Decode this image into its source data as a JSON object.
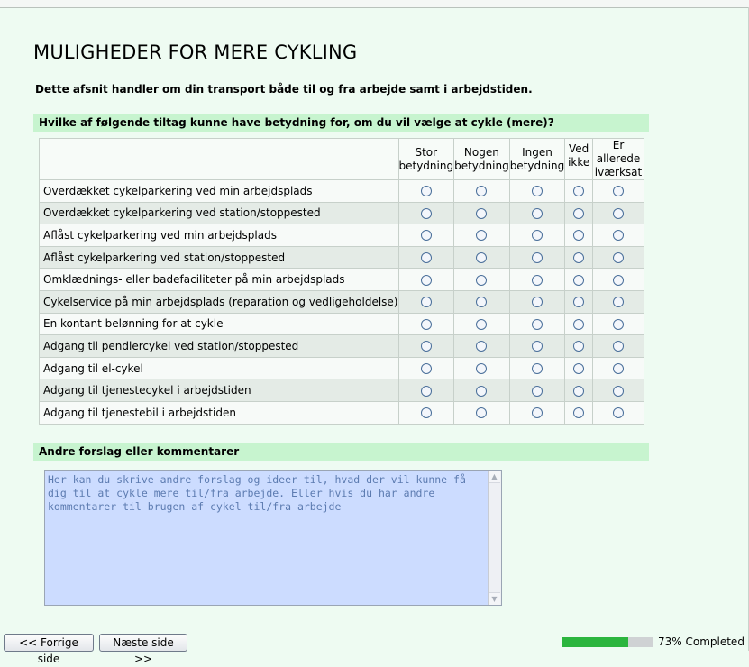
{
  "page": {
    "title": "MULIGHEDER FOR MERE CYKLING",
    "intro": "Dette afsnit handler om din transport både til og fra arbejde samt i arbejdstiden."
  },
  "question": {
    "label": "Hvilke af følgende tiltag kunne have betydning for, om du vil vælge at cykle (mere)?",
    "columns": [
      {
        "line1": "Stor",
        "line2": "betydning"
      },
      {
        "line1": "Nogen",
        "line2": "betydning"
      },
      {
        "line1": "Ingen",
        "line2": "betydning"
      },
      {
        "line1": "Ved ikke",
        "line2": ""
      },
      {
        "line1": "Er allerede",
        "line2": "iværksat"
      }
    ],
    "rows": [
      "Overdækket cykelparkering ved min arbejdsplads",
      "Overdækket cykelparkering ved station/stoppested",
      "Aflåst cykelparkering ved min arbejdsplads",
      "Aflåst cykelparkering ved station/stoppested",
      "Omklædnings- eller badefaciliteter på min arbejdsplads",
      "Cykelservice på min arbejdsplads (reparation og vedligeholdelse)",
      "En kontant belønning for at cykle",
      "Adgang til pendlercykel ved station/stoppested",
      "Adgang til el-cykel",
      "Adgang til tjenestecykel i arbejdstiden",
      "Adgang til tjenestebil i arbejdstiden"
    ]
  },
  "comments": {
    "label": "Andre forslag eller kommentarer",
    "placeholder": "Her kan du skrive andre forslag og ideer til, hvad der vil kunne få dig til at cykle mere til/fra arbejde. Eller hvis du har andre kommentarer til brugen af cykel til/fra arbejde"
  },
  "nav": {
    "prev_label": "<< Forrige side",
    "next_label": "Næste side >>"
  },
  "progress": {
    "percent": 73,
    "label": "73% Completed"
  },
  "colors": {
    "section_bar": "#c7f4cf",
    "page_bg": "#eefbf2",
    "textarea_bg": "#ccdcff",
    "progress_fill": "#2bb53e"
  }
}
